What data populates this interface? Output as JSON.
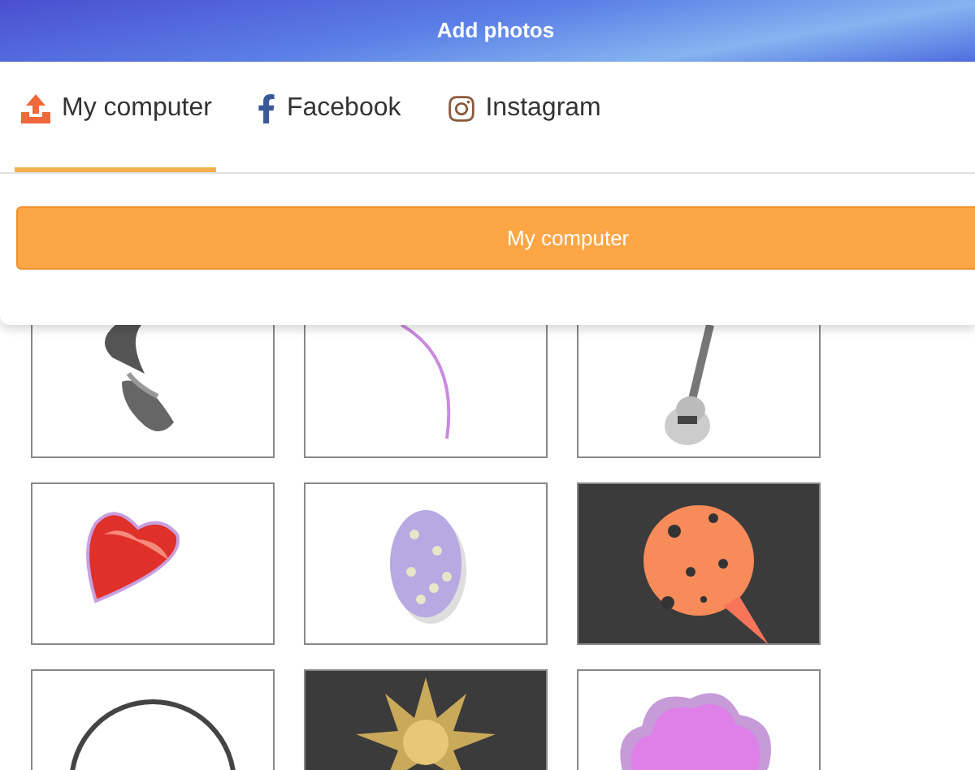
{
  "header": {
    "title": "Add photos"
  },
  "tabs": [
    {
      "label": "My computer",
      "selected": true
    },
    {
      "label": "Facebook",
      "selected": false
    },
    {
      "label": "Instagram",
      "selected": false
    }
  ],
  "upload_button": {
    "label": "My computer"
  }
}
